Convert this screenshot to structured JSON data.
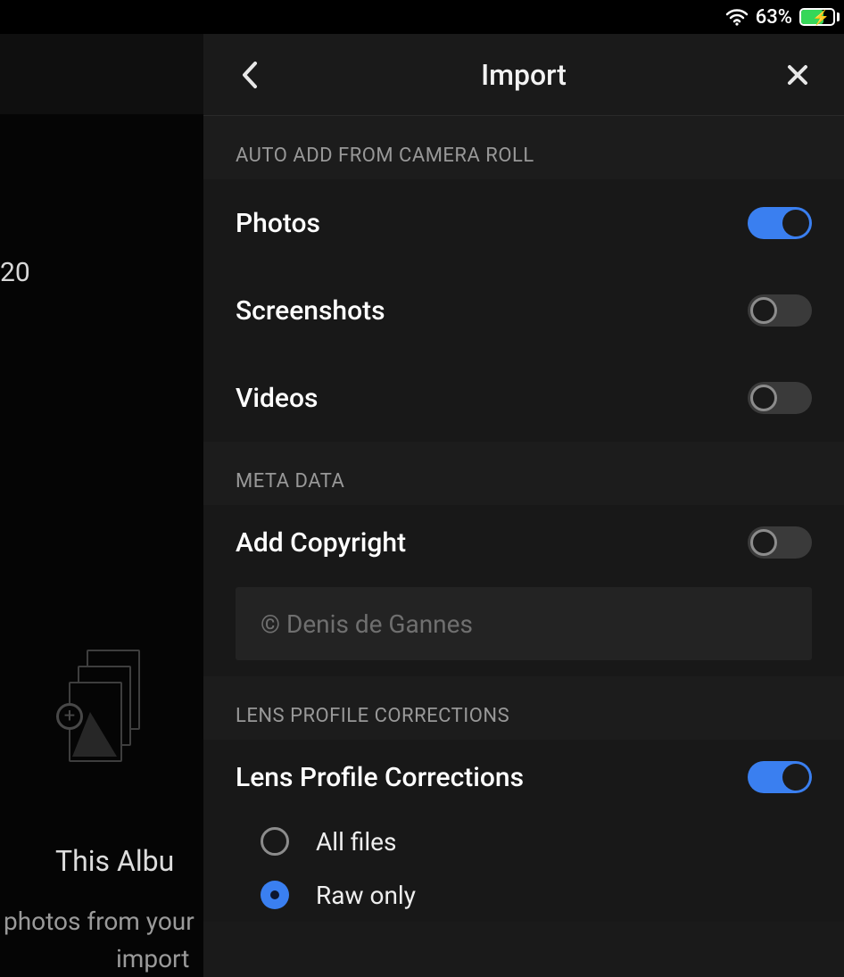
{
  "status": {
    "battery_pct": "63%"
  },
  "background": {
    "truncated_number": "20",
    "line1": "This Albu",
    "line2": "photos from your",
    "line3": "import"
  },
  "panel": {
    "title": "Import",
    "sections": {
      "auto_add": {
        "header": "AUTO ADD FROM CAMERA ROLL",
        "items": [
          {
            "label": "Photos",
            "on": true
          },
          {
            "label": "Screenshots",
            "on": false
          },
          {
            "label": "Videos",
            "on": false
          }
        ]
      },
      "meta": {
        "header": "META DATA",
        "add_copyright_label": "Add Copyright",
        "add_copyright_on": false,
        "copyright_placeholder": "© Denis de Gannes"
      },
      "lens": {
        "header": "LENS PROFILE CORRECTIONS",
        "toggle_label": "Lens Profile Corrections",
        "toggle_on": true,
        "options": [
          {
            "label": "All files",
            "selected": false
          },
          {
            "label": "Raw only",
            "selected": true
          }
        ]
      }
    }
  }
}
